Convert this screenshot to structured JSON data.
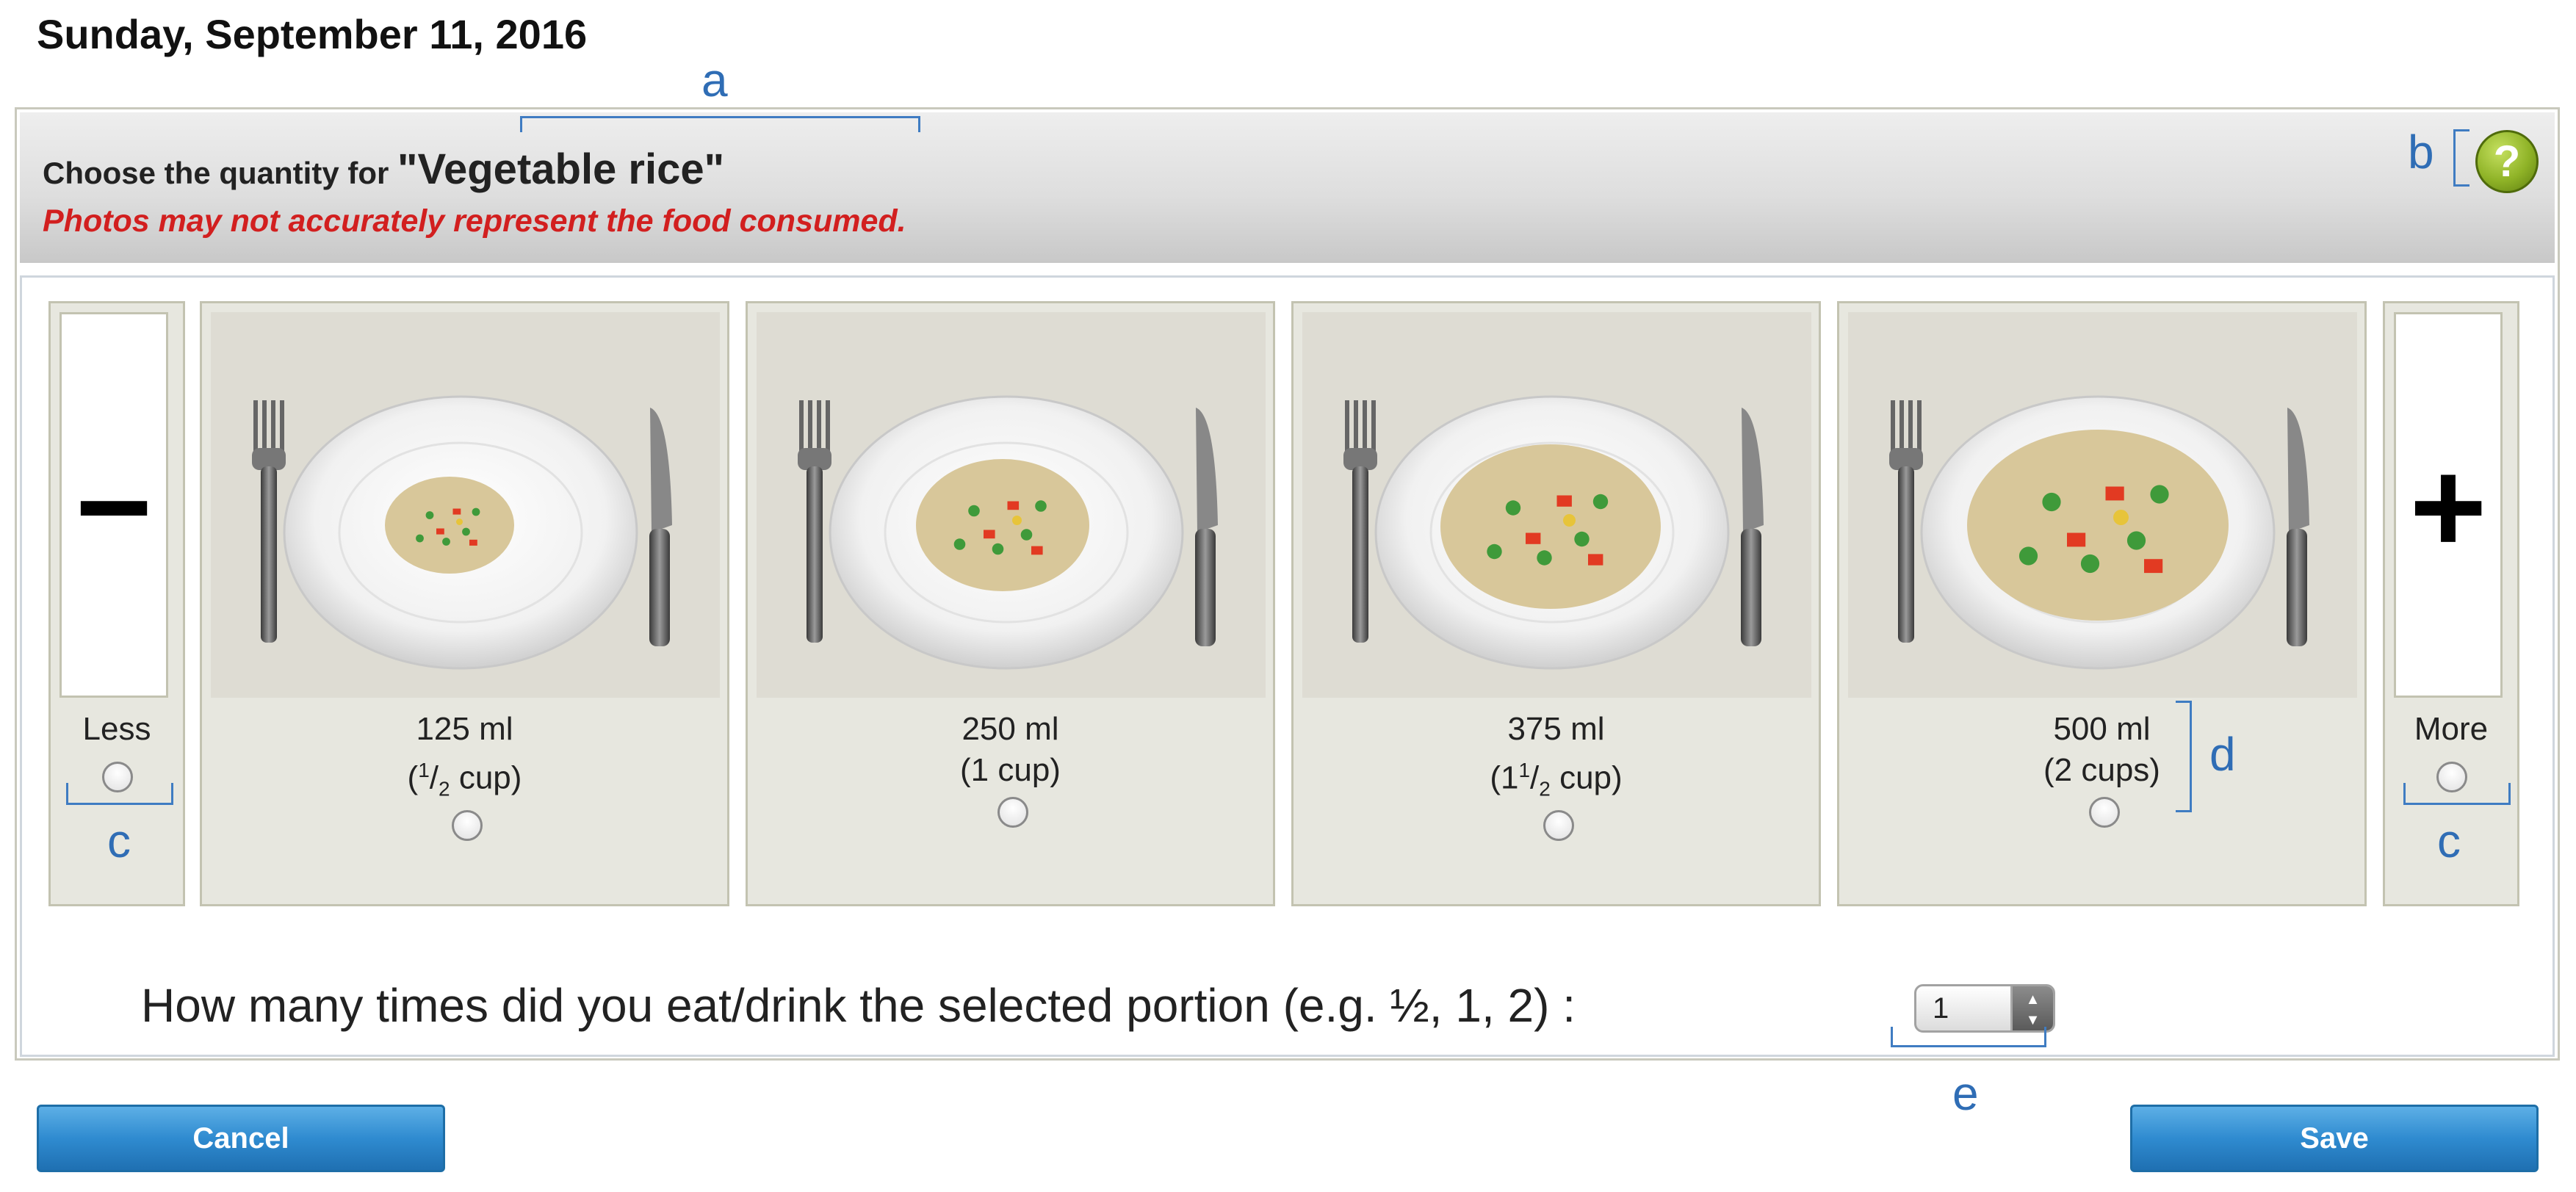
{
  "date": "Sunday, September 11, 2016",
  "header": {
    "prompt": "Choose the quantity for",
    "food": "\"Vegetable rice\"",
    "warning": "Photos may not accurately represent the food consumed.",
    "help_symbol": "?"
  },
  "less": {
    "symbol": "−",
    "label": "Less"
  },
  "more": {
    "symbol": "+",
    "label": "More"
  },
  "portions": [
    {
      "amount": "125 ml",
      "cup_whole": "",
      "cup_num": "1",
      "cup_den": "2",
      "cup_unit": "cup"
    },
    {
      "amount": "250 ml",
      "cup_text": "(1 cup)"
    },
    {
      "amount": "375 ml",
      "cup_whole": "1",
      "cup_num": "1",
      "cup_den": "2",
      "cup_unit": "cup"
    },
    {
      "amount": "500 ml",
      "cup_text": "(2 cups)"
    }
  ],
  "question": "How many times did you eat/drink the selected portion (e.g. ½, 1, 2) :",
  "quantity_value": "1",
  "buttons": {
    "cancel": "Cancel",
    "save": "Save"
  },
  "annotations": {
    "a": "a",
    "b": "b",
    "c": "c",
    "d": "d",
    "e": "e"
  },
  "colors": {
    "warning": "#d21f1f",
    "button": "#2f8bd0",
    "annotation": "#2f6db5",
    "help": "#8fb327"
  },
  "icons": {
    "help": "question-mark-icon",
    "less": "minus-icon",
    "more": "plus-icon"
  }
}
